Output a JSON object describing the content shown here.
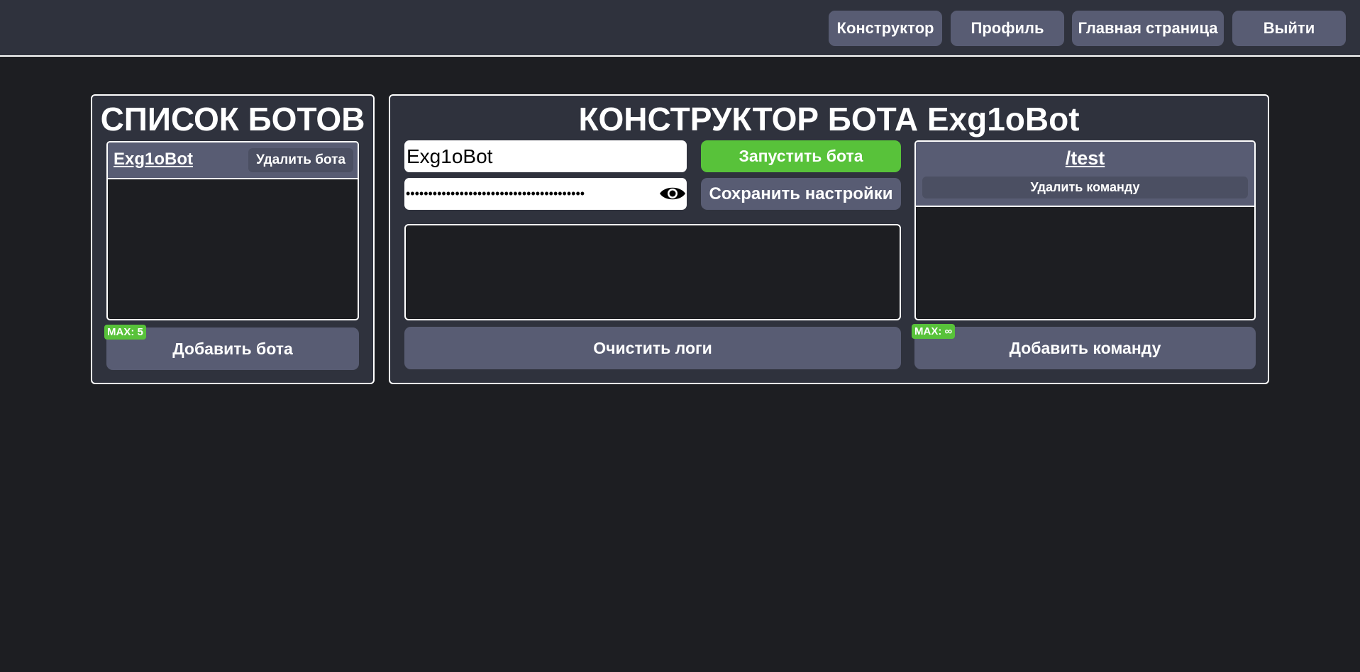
{
  "nav": {
    "constructor": "Конструктор",
    "profile": "Профиль",
    "home": "Главная страница",
    "logout": "Выйти"
  },
  "bot_list": {
    "title": "СПИСОК БОТОВ",
    "items": [
      {
        "name": "Exg1oBot",
        "delete_label": "Удалить бота"
      }
    ],
    "max_badge": "MAX: 5",
    "add_label": "Добавить бота"
  },
  "builder": {
    "title": "КОНСТРУКТОР БОТА Exg1oBot",
    "bot_name_value": "Exg1oBot",
    "token_masked": "••••••••••••••••••••••••••••••••••••••••",
    "start_label": "Запустить бота",
    "save_label": "Сохранить настройки",
    "clear_logs_label": "Очистить логи",
    "commands": [
      {
        "name": "/test",
        "delete_label": "Удалить команду"
      }
    ],
    "commands_max_badge": "MAX: ∞",
    "add_command_label": "Добавить команду"
  },
  "colors": {
    "background": "#1d1e22",
    "panel": "#2f323d",
    "button": "#585c73",
    "accent_green": "#58c23a"
  }
}
